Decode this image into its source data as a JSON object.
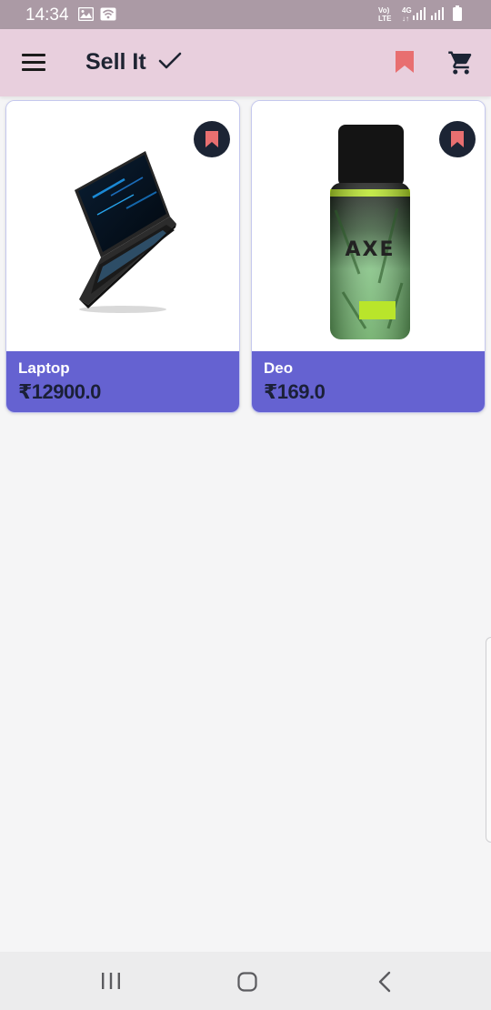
{
  "status_bar": {
    "time": "14:34",
    "network_top": "Vo)",
    "network_bottom": "LTE",
    "gen_top": "4G",
    "gen_bottom": "↓↑"
  },
  "app_bar": {
    "title": "Sell It",
    "icons": [
      "menu-icon",
      "check-icon",
      "bookmark-icon",
      "cart-icon"
    ],
    "accent": "#e8cfdd",
    "bookmark_color": "#e86f70"
  },
  "products": [
    {
      "name": "Laptop",
      "price": "₹12900.0",
      "image": "laptop-image"
    },
    {
      "name": "Deo",
      "price": "₹169.0",
      "image": "deodorant-image"
    }
  ],
  "colors": {
    "card_footer": "#6562d1",
    "price_text": "#1b2038",
    "fav_button": "#1c2434"
  }
}
